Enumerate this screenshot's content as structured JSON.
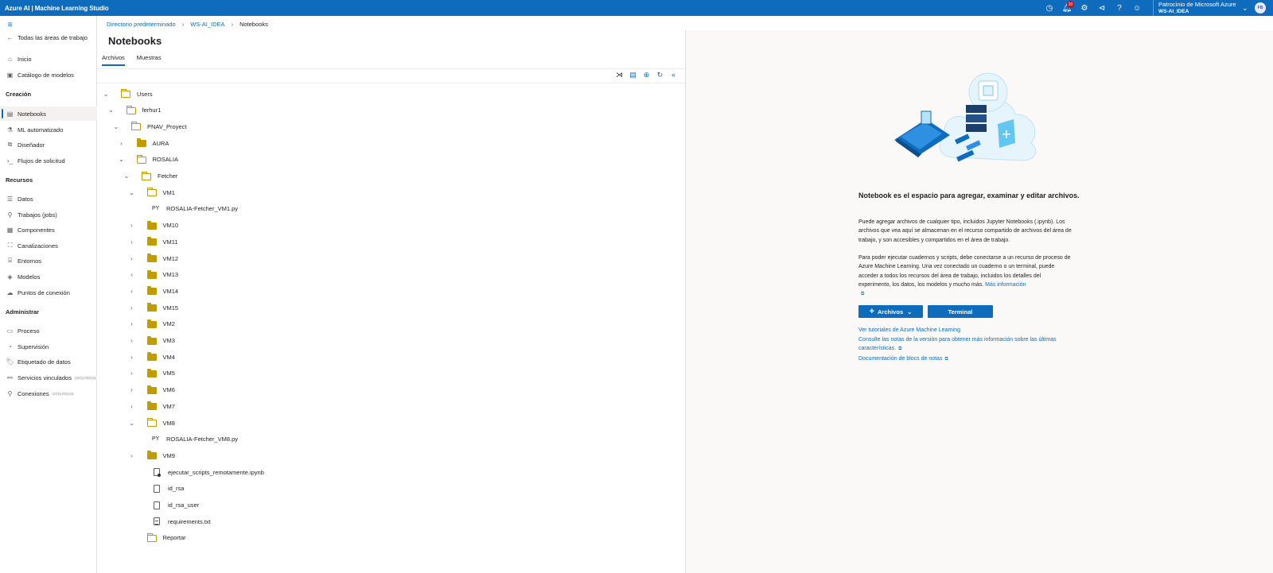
{
  "app": {
    "title": "Azure AI | Machine Learning Studio"
  },
  "topbar": {
    "notification_count": "20",
    "account_line1": "Patrocinio de Microsoft Azure",
    "account_line2": "WS-AI_IDEA",
    "avatar_initials": "FB",
    "icons": [
      "clock-icon",
      "bell-icon",
      "gear-icon",
      "megaphone-icon",
      "help-icon",
      "smiley-icon"
    ]
  },
  "sidebar": {
    "back_label": "Todas las áreas de trabajo",
    "items_top": [
      {
        "label": "Inicio",
        "icon": "home-icon"
      },
      {
        "label": "Catálogo de modelos",
        "icon": "catalog-icon"
      }
    ],
    "section_creacion": "Creación",
    "items_creacion": [
      {
        "label": "Notebooks",
        "icon": "notebook-icon"
      },
      {
        "label": "ML automatizado",
        "icon": "automl-icon"
      },
      {
        "label": "Diseñador",
        "icon": "designer-icon"
      },
      {
        "label": "Flujos de solicitud",
        "icon": "prompt-flow-icon"
      }
    ],
    "section_recursos": "Recursos",
    "items_recursos": [
      {
        "label": "Datos",
        "icon": "data-icon"
      },
      {
        "label": "Trabajos (jobs)",
        "icon": "jobs-icon"
      },
      {
        "label": "Componentes",
        "icon": "components-icon"
      },
      {
        "label": "Canalizaciones",
        "icon": "pipelines-icon"
      },
      {
        "label": "Entornos",
        "icon": "environments-icon"
      },
      {
        "label": "Modelos",
        "icon": "models-icon"
      },
      {
        "label": "Puntos de conexión",
        "icon": "endpoints-icon"
      }
    ],
    "section_administrar": "Administrar",
    "items_administrar": [
      {
        "label": "Proceso",
        "icon": "compute-icon"
      },
      {
        "label": "Supervisión",
        "icon": "monitoring-icon"
      },
      {
        "label": "Etiquetado de datos",
        "icon": "labeling-icon"
      },
      {
        "label": "Servicios vinculados",
        "icon": "linked-services-icon",
        "tag": "VISTA PREVIA"
      },
      {
        "label": "Conexiones",
        "icon": "connections-icon",
        "tag": "VISTA PREVIA"
      }
    ]
  },
  "breadcrumb": [
    "Directorio predeterminado",
    "WS-AI_IDEA",
    "Notebooks"
  ],
  "main": {
    "title": "Notebooks",
    "tabs": [
      "Archivos",
      "Muestras"
    ]
  },
  "tree": [
    {
      "label": "Users",
      "type": "folder-open"
    },
    {
      "label": "ferhur1",
      "type": "folder-open"
    },
    {
      "label": "PNAV_Proyect",
      "type": "folder-open"
    },
    {
      "label": "AURA",
      "type": "folder-closed"
    },
    {
      "label": "ROSALIA",
      "type": "folder-open"
    },
    {
      "label": "Fetcher",
      "type": "folder-open"
    },
    {
      "label": "VM1",
      "type": "folder-open"
    },
    {
      "label": "ROSALIA-Fetcher_VM1.py",
      "type": "py",
      "tag": "PY"
    },
    {
      "label": "VM10",
      "type": "folder-closed"
    },
    {
      "label": "VM11",
      "type": "folder-closed"
    },
    {
      "label": "VM12",
      "type": "folder-closed"
    },
    {
      "label": "VM13",
      "type": "folder-closed"
    },
    {
      "label": "VM14",
      "type": "folder-closed"
    },
    {
      "label": "VM15",
      "type": "folder-closed"
    },
    {
      "label": "VM2",
      "type": "folder-closed"
    },
    {
      "label": "VM3",
      "type": "folder-closed"
    },
    {
      "label": "VM4",
      "type": "folder-closed"
    },
    {
      "label": "VM5",
      "type": "folder-closed"
    },
    {
      "label": "VM6",
      "type": "folder-closed"
    },
    {
      "label": "VM7",
      "type": "folder-closed"
    },
    {
      "label": "VM8",
      "type": "folder-open"
    },
    {
      "label": "ROSALIA-Fetcher_VM8.py",
      "type": "py",
      "tag": "PY"
    },
    {
      "label": "VM9",
      "type": "folder-closed"
    },
    {
      "label": "ejecutar_scripts_remotamente.ipynb",
      "type": "notebook"
    },
    {
      "label": "id_rsa",
      "type": "file"
    },
    {
      "label": "id_rsa_user",
      "type": "file"
    },
    {
      "label": "requirements.txt",
      "type": "text"
    },
    {
      "label": "Reportar",
      "type": "folder-open"
    }
  ],
  "info": {
    "title": "Notebook es el espacio para agregar, examinar y editar archivos.",
    "para1": "Puede agregar archivos de cualquier tipo, incluidos Jupyter Notebooks (.ipynb). Los archivos que vea aquí se almacenan en el recurso compartido de archivos del área de trabajo, y son accesibles y compartidos en el área de trabajo.",
    "para2": "Para poder ejecutar cuadernos y scripts, debe conectarse a un recurso de proceso de Azure Machine Learning. Una vez conectado un cuaderno o un terminal, puede acceder a todos los recursos del área de trabajo, incluidos los detalles del experimento, los datos, los modelos y mucho más.",
    "more_info": "Más información",
    "btn_files": "Archivos",
    "btn_terminal": "Terminal",
    "link1": "Ver tutoriales de Azure Machine Learning",
    "link2": "Consulte las notas de la versión para obtener más información sobre las últimas características.",
    "link3": "Documentación de blocs de notas"
  }
}
